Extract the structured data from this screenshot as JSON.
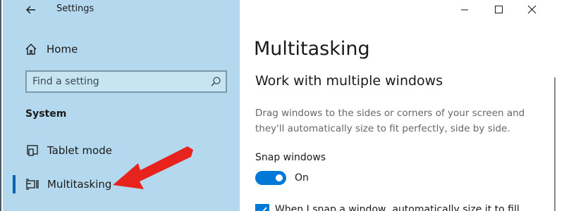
{
  "window": {
    "title": "Settings"
  },
  "sidebar": {
    "home_label": "Home",
    "search": {
      "placeholder": "Find a setting"
    },
    "section_heading": "System",
    "items": [
      {
        "label": "Tablet mode",
        "icon": "tablet-mode-icon",
        "selected": false
      },
      {
        "label": "Multitasking",
        "icon": "multitasking-icon",
        "selected": true
      }
    ]
  },
  "main": {
    "page_title": "Multitasking",
    "section_title": "Work with multiple windows",
    "description": "Drag windows to the sides or corners of your screen and they'll automatically size to fit perfectly, side by side.",
    "snap": {
      "label": "Snap windows",
      "state_label": "On",
      "enabled": true
    },
    "auto_size_checkbox": {
      "label": "When I snap a window, automatically size it to fill",
      "checked": true
    }
  },
  "colors": {
    "sidebar_bg": "#b4d9ee",
    "accent": "#0078d7",
    "arrow": "#e8231e"
  }
}
